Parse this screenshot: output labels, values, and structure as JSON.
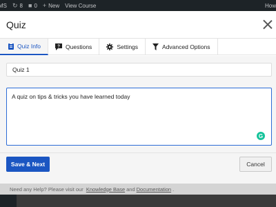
{
  "adminbar": {
    "site_fragment": "MS",
    "updates_count": "8",
    "comments_count": "0",
    "new_label": "New",
    "view_course_label": "View Course",
    "howdy_fragment": "How"
  },
  "modal": {
    "title": "Quiz",
    "tabs": [
      {
        "label": "Quiz Info",
        "icon": "clipboard-icon",
        "active": true
      },
      {
        "label": "Questions",
        "icon": "question-icon",
        "active": false
      },
      {
        "label": "Settings",
        "icon": "gear-icon",
        "active": false
      },
      {
        "label": "Advanced Options",
        "icon": "filter-icon",
        "active": false
      }
    ],
    "quiz_name_value": "Quiz 1",
    "quiz_description_value": "A quiz on tips & tricks you have learned today",
    "save_next_label": "Save & Next",
    "cancel_label": "Cancel"
  },
  "footer": {
    "text_before": "Need any Help? Please visit our",
    "link_knowledge_base": "Knowledge Base",
    "text_and": "and",
    "link_documentation": "Documentation",
    "text_after": "."
  },
  "colors": {
    "accent": "#1b56c2",
    "adminbar_bg": "#1d2327",
    "grammarly": "#15c39a"
  }
}
